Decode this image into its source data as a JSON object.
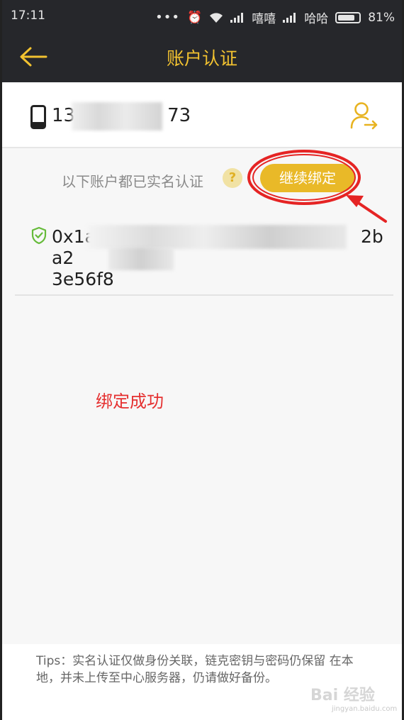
{
  "status_bar": {
    "time": "17:11",
    "carrier1": "嘻嘻",
    "carrier2": "哈哈",
    "battery": "81%",
    "battery_level": 0.81
  },
  "header": {
    "title": "账户认证",
    "back_icon": "back-arrow-icon",
    "accent_color": "#f2c230"
  },
  "account": {
    "phone_prefix": "13",
    "phone_suffix": "73",
    "phone_icon": "smartphone-icon",
    "switch_icon": "user-switch-icon"
  },
  "verified": {
    "label": "以下账户都已实名认证",
    "help_icon": "?",
    "continue_button": "继续绑定",
    "button_color": "#e9b928"
  },
  "address": {
    "line1_start": "0x1a",
    "line1_end": "2ba2",
    "line2_start": "3e56f8",
    "shield_icon": "shield-check-icon"
  },
  "annotation": {
    "text": "绑定成功",
    "color": "#e53030"
  },
  "tips": {
    "text": "Tips：实名认证仅做身份关联，链克密钥与密码仍保留 在本地，并未上传至中心服务器，仍请做好备份。"
  },
  "watermark": {
    "text": "Bai 经验",
    "sub": "jingyan.baidu.com"
  }
}
